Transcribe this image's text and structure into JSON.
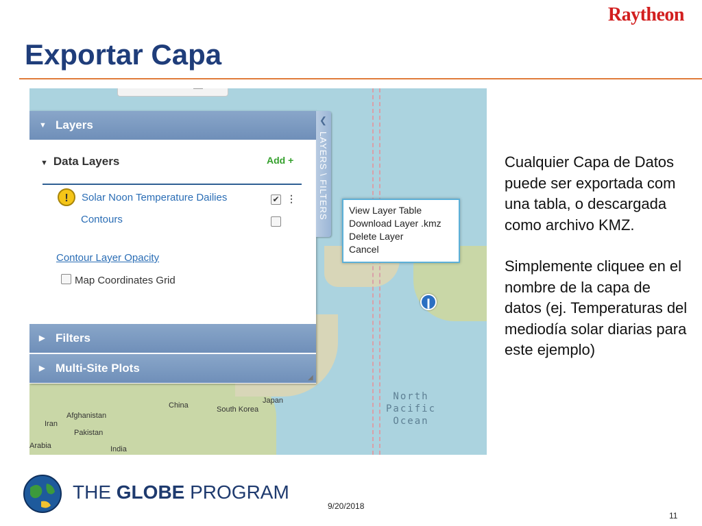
{
  "brand": {
    "raytheon": "Raytheon",
    "globe_the": "THE ",
    "globe_globe": "GLOBE",
    "globe_program": " PROGRAM"
  },
  "title": "Exportar Capa",
  "screenshot": {
    "panel": {
      "layers_header": "Layers",
      "data_layers_header": "Data Layers",
      "add_label": "Add +",
      "layers": [
        {
          "label": "Solar Noon Temperature Dailies",
          "checked": true
        },
        {
          "label": "Contours",
          "checked": false
        }
      ],
      "contour_opacity": "Contour Layer Opacity",
      "map_grid_label": "Map Coordinates Grid",
      "filters_header": "Filters",
      "multisite_header": "Multi-Site Plots",
      "side_tab_label": "LAYERS \\ FILTERS"
    },
    "context_menu": [
      "View Layer Table",
      "Download Layer .kmz",
      "Delete Layer",
      "Cancel"
    ],
    "map_labels": {
      "japan": "Japan",
      "china": "China",
      "south_korea": "South Korea",
      "afghanistan": "Afghanistan",
      "iran": "Iran",
      "pakistan": "Pakistan",
      "arabia": "Arabia",
      "india": "India",
      "ocean": "North\nPacific\nOcean"
    }
  },
  "description": {
    "paragraph1": "Cualquier Capa de Datos puede ser exportada com una tabla, o descargada como archivo KMZ.",
    "paragraph2": "Simplemente cliquee en el nombre de la capa de datos (ej. Temperaturas del mediodía solar diarias para este ejemplo)"
  },
  "footer": {
    "date": "9/20/2018",
    "page": "11"
  },
  "colors": {
    "title": "#1f3d7a",
    "accent_rule": "#e07b39",
    "raytheon_red": "#d21f1f",
    "panel_header": "#7a99c2"
  }
}
